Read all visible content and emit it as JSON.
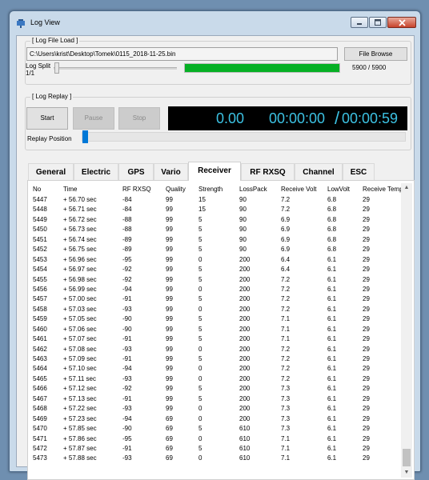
{
  "window": {
    "title": "Log View"
  },
  "log_file_load": {
    "group_label": "[ Log File Load ]",
    "file_path": "C:\\Users\\krist\\Desktop\\Tomek\\0115_2018-11-25.bin",
    "browse_button": "File Browse",
    "split_label": "Log Split",
    "split_value": "1/1",
    "progress_fraction": 1.0,
    "progress_text": "5900 / 5900"
  },
  "log_replay": {
    "group_label": "[ Log Replay ]",
    "start_button": "Start",
    "pause_button": "Pause",
    "stop_button": "Stop",
    "display_value": "0.00",
    "display_time": "00:00:00",
    "display_separator": "/",
    "display_total": "00:00:59",
    "replay_position_label": "Replay Position",
    "display_color": "#3cc2e3"
  },
  "tabs": [
    "General",
    "Electric",
    "GPS",
    "Vario",
    "Receiver",
    "RF RXSQ",
    "Channel",
    "ESC"
  ],
  "active_tab": "Receiver",
  "table": {
    "columns": [
      "No",
      "Time",
      "RF RXSQ",
      "Quality",
      "Strength",
      "LossPack",
      "Receive Volt",
      "LowVolt",
      "Receive Temp"
    ],
    "rows": [
      [
        "5447",
        "+ 56.70 sec",
        "-84",
        "99",
        "15",
        "90",
        "7.2",
        "6.8",
        "29"
      ],
      [
        "5448",
        "+ 56.71 sec",
        "-84",
        "99",
        "15",
        "90",
        "7.2",
        "6.8",
        "29"
      ],
      [
        "5449",
        "+ 56.72 sec",
        "-88",
        "99",
        "5",
        "90",
        "6.9",
        "6.8",
        "29"
      ],
      [
        "5450",
        "+ 56.73 sec",
        "-88",
        "99",
        "5",
        "90",
        "6.9",
        "6.8",
        "29"
      ],
      [
        "5451",
        "+ 56.74 sec",
        "-89",
        "99",
        "5",
        "90",
        "6.9",
        "6.8",
        "29"
      ],
      [
        "5452",
        "+ 56.75 sec",
        "-89",
        "99",
        "5",
        "90",
        "6.9",
        "6.8",
        "29"
      ],
      [
        "5453",
        "+ 56.96 sec",
        "-95",
        "99",
        "0",
        "200",
        "6.4",
        "6.1",
        "29"
      ],
      [
        "5454",
        "+ 56.97 sec",
        "-92",
        "99",
        "5",
        "200",
        "6.4",
        "6.1",
        "29"
      ],
      [
        "5455",
        "+ 56.98 sec",
        "-92",
        "99",
        "5",
        "200",
        "7.2",
        "6.1",
        "29"
      ],
      [
        "5456",
        "+ 56.99 sec",
        "-94",
        "99",
        "0",
        "200",
        "7.2",
        "6.1",
        "29"
      ],
      [
        "5457",
        "+ 57.00 sec",
        "-91",
        "99",
        "5",
        "200",
        "7.2",
        "6.1",
        "29"
      ],
      [
        "5458",
        "+ 57.03 sec",
        "-93",
        "99",
        "0",
        "200",
        "7.2",
        "6.1",
        "29"
      ],
      [
        "5459",
        "+ 57.05 sec",
        "-90",
        "99",
        "5",
        "200",
        "7.1",
        "6.1",
        "29"
      ],
      [
        "5460",
        "+ 57.06 sec",
        "-90",
        "99",
        "5",
        "200",
        "7.1",
        "6.1",
        "29"
      ],
      [
        "5461",
        "+ 57.07 sec",
        "-91",
        "99",
        "5",
        "200",
        "7.1",
        "6.1",
        "29"
      ],
      [
        "5462",
        "+ 57.08 sec",
        "-93",
        "99",
        "0",
        "200",
        "7.2",
        "6.1",
        "29"
      ],
      [
        "5463",
        "+ 57.09 sec",
        "-91",
        "99",
        "5",
        "200",
        "7.2",
        "6.1",
        "29"
      ],
      [
        "5464",
        "+ 57.10 sec",
        "-94",
        "99",
        "0",
        "200",
        "7.2",
        "6.1",
        "29"
      ],
      [
        "5465",
        "+ 57.11 sec",
        "-93",
        "99",
        "0",
        "200",
        "7.2",
        "6.1",
        "29"
      ],
      [
        "5466",
        "+ 57.12 sec",
        "-92",
        "99",
        "5",
        "200",
        "7.3",
        "6.1",
        "29"
      ],
      [
        "5467",
        "+ 57.13 sec",
        "-91",
        "99",
        "5",
        "200",
        "7.3",
        "6.1",
        "29"
      ],
      [
        "5468",
        "+ 57.22 sec",
        "-93",
        "99",
        "0",
        "200",
        "7.3",
        "6.1",
        "29"
      ],
      [
        "5469",
        "+ 57.23 sec",
        "-94",
        "69",
        "0",
        "200",
        "7.3",
        "6.1",
        "29"
      ],
      [
        "5470",
        "+ 57.85 sec",
        "-90",
        "69",
        "5",
        "610",
        "7.3",
        "6.1",
        "29"
      ],
      [
        "5471",
        "+ 57.86 sec",
        "-95",
        "69",
        "0",
        "610",
        "7.1",
        "6.1",
        "29"
      ],
      [
        "5472",
        "+ 57.87 sec",
        "-91",
        "69",
        "5",
        "610",
        "7.1",
        "6.1",
        "29"
      ],
      [
        "5473",
        "+ 57.88 sec",
        "-93",
        "69",
        "0",
        "610",
        "7.1",
        "6.1",
        "29"
      ]
    ]
  },
  "colors": {
    "progress": "#06b025",
    "display_background": "#000000",
    "replay_thumb": "#0078d7"
  }
}
